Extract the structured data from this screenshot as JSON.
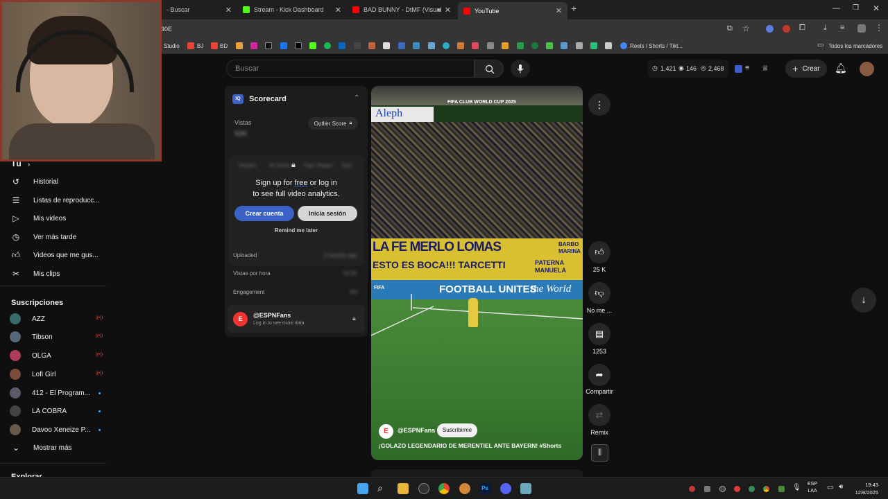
{
  "tabs": [
    {
      "title": "- Buscar",
      "active": false
    },
    {
      "title": "Stream - Kick Dashboard",
      "active": false
    },
    {
      "title": "BAD BUNNY - DtMF (Visual",
      "active": false
    },
    {
      "title": "YouTube",
      "active": true
    }
  ],
  "new_tab": "+",
  "address": {
    "url": "30E"
  },
  "bookmarks": {
    "studio": "Studio",
    "bj": "BJ",
    "bd": "BD",
    "reels": "Reels / Shorts / Tikt...",
    "all": "Todos los marcadores"
  },
  "header": {
    "search_placeholder": "Buscar",
    "stat1": "1,421",
    "stat2": "146",
    "stat3": "2,468",
    "create": "Crear"
  },
  "sidebar": {
    "you": "Tú",
    "items": [
      {
        "label": "Historial",
        "icon": "history-icon"
      },
      {
        "label": "Listas de reproducc...",
        "icon": "playlist-icon"
      },
      {
        "label": "Mis videos",
        "icon": "video-icon"
      },
      {
        "label": "Ver más tarde",
        "icon": "clock-icon"
      },
      {
        "label": "Videos que me gus...",
        "icon": "thumbs-up-icon"
      },
      {
        "label": "Mis clips",
        "icon": "scissors-icon"
      }
    ],
    "subs_title": "Suscripciones",
    "subs": [
      {
        "name": "AZZ",
        "color": "#3a6b6b",
        "live": true
      },
      {
        "name": "Tibson",
        "color": "#556677",
        "live": true
      },
      {
        "name": "OLGA",
        "color": "#b03a5a",
        "live": true
      },
      {
        "name": "Lofi Girl",
        "color": "#7a4a3a",
        "live": true
      },
      {
        "name": "412 - El Program...",
        "color": "#5a5a6a",
        "live": false
      },
      {
        "name": "LA COBRA",
        "color": "#444",
        "live": false
      },
      {
        "name": "Davoo Xeneize P...",
        "color": "#6a5a4a",
        "live": false
      }
    ],
    "show_more": "Mostrar más",
    "explore": "Explorar"
  },
  "scorecard": {
    "logo": "IQ",
    "title": "Scorecard",
    "vistas": "Vistas",
    "vistas_value": "52K",
    "outlier": "Outlier Score",
    "blur_tabs": [
      "Similars",
      "Alt Shorts",
      "Topic Shapes",
      "Tabs"
    ],
    "signup_a": "Sign up for ",
    "signup_free": "free",
    "signup_b": " or log in",
    "signup_c": "to see full video analytics.",
    "crear": "Crear cuenta",
    "inicia": "Inicia sesión",
    "remind": "Remind me later",
    "uploaded": "Uploaded",
    "uploaded_val": "2 months ago",
    "vph": "Vistas por hora",
    "vph_val": "18.0K",
    "engagement": "Engagement",
    "engagement_val": "4%",
    "channel": "@ESPNFans",
    "channel_sub": "Log in to see more data"
  },
  "video": {
    "logo": "Aleph",
    "banner": "FIFA CLUB WORLD CUP 2025",
    "sign1": "LA FE MERLO LOMAS",
    "sign2": "ESTO ES BOCA!!! TARCETTI",
    "sign3": "BARBO MARINA",
    "sign4": "PATERNA MANUELA",
    "board": "FOOTBALL UNITES",
    "board2": "the World",
    "channel": "@ESPNFans",
    "subscribe": "Suscribirme",
    "caption": "¡GOLAZO LEGENDARIO DE MERENTIEL ANTE BAYERN! #Shorts"
  },
  "actions": {
    "likes": "25 K",
    "dislike": "No me ...",
    "comments": "1253",
    "share": "Compartir",
    "remix": "Remix"
  },
  "taskbar": {
    "lang": "ESP",
    "lang2": "LAA",
    "time": "19:43",
    "date": "12/8/2025"
  }
}
